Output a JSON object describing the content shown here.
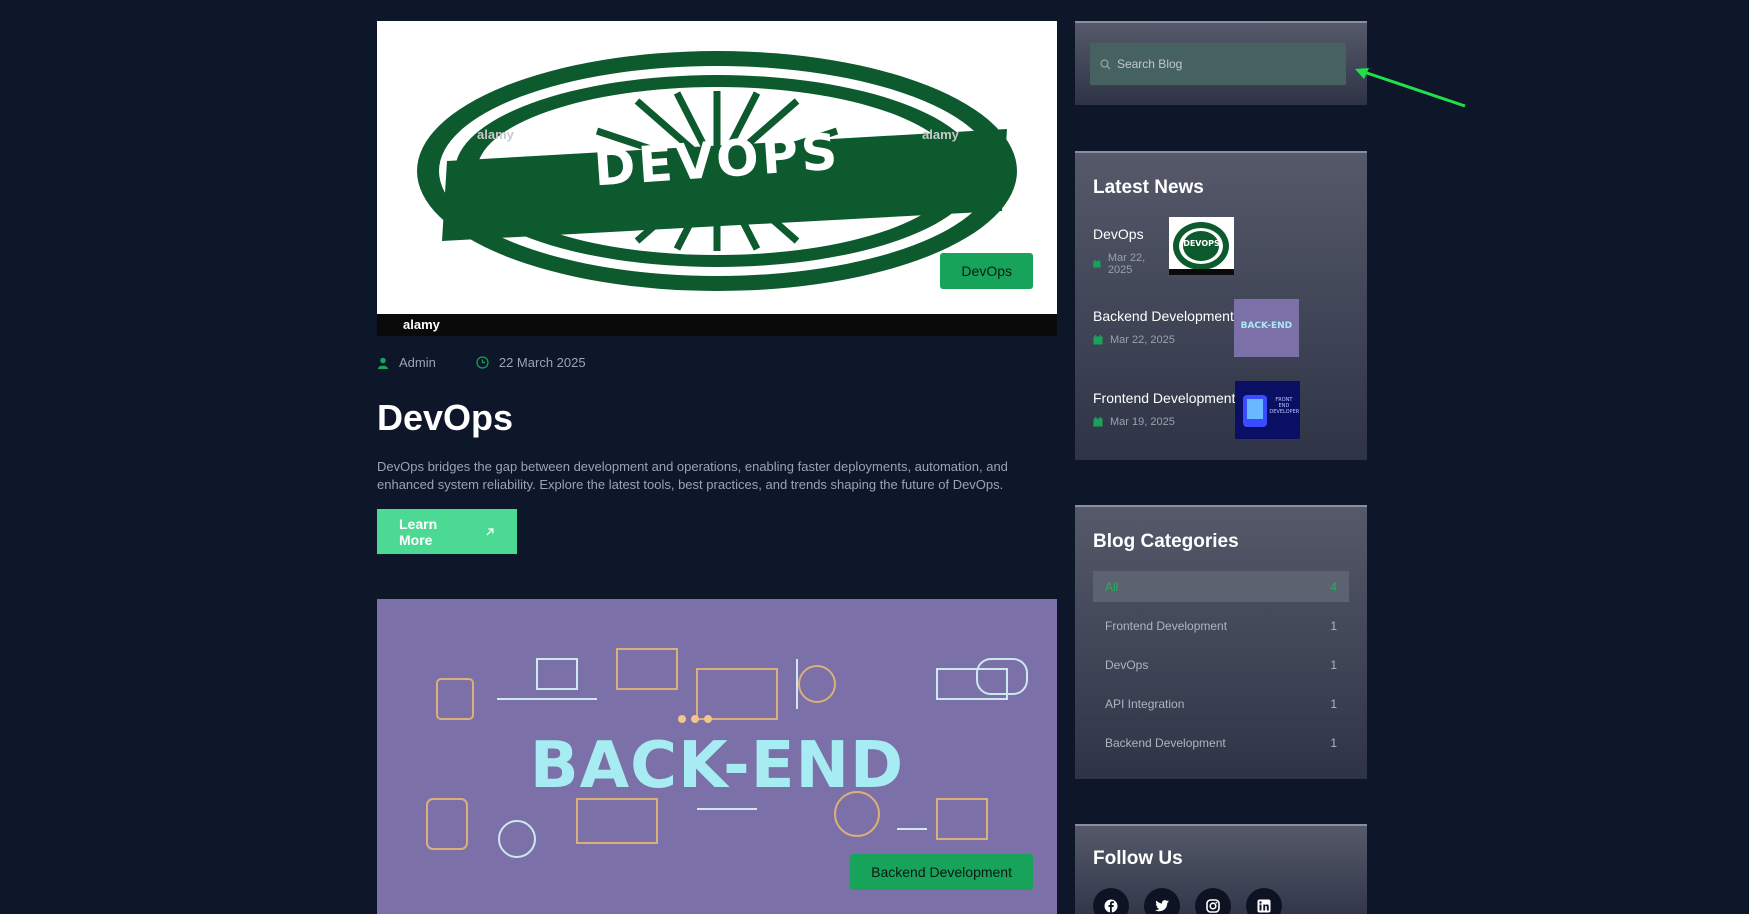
{
  "posts": [
    {
      "image_text": "DEVOPS",
      "image_watermark": "alamy",
      "category": "DevOps",
      "author": "Admin",
      "date": "22 March 2025",
      "title": "DevOps",
      "excerpt": "DevOps bridges the gap between development and operations, enabling faster deployments, automation, and enhanced system reliability. Explore the latest tools, best practices, and trends shaping the future of DevOps.",
      "cta": "Learn More"
    },
    {
      "image_text": "BACK-END",
      "category": "Backend Development"
    }
  ],
  "search": {
    "placeholder": "Search Blog"
  },
  "latest_news": {
    "title": "Latest News",
    "items": [
      {
        "title": "DevOps",
        "date": "Mar 22, 2025",
        "thumb_text": "DEVOPS"
      },
      {
        "title": "Backend Development",
        "date": "Mar 22, 2025",
        "thumb_text": "BACK-END"
      },
      {
        "title": "Frontend Development",
        "date": "Mar 19, 2025",
        "thumb_text": "FRONT END DEVELOPER"
      }
    ]
  },
  "categories": {
    "title": "Blog Categories",
    "items": [
      {
        "label": "All",
        "count": "4"
      },
      {
        "label": "Frontend Development",
        "count": "1"
      },
      {
        "label": "DevOps",
        "count": "1"
      },
      {
        "label": "API Integration",
        "count": "1"
      },
      {
        "label": "Backend Development",
        "count": "1"
      }
    ]
  },
  "follow": {
    "title": "Follow Us",
    "icons": [
      "facebook-icon",
      "twitter-icon",
      "instagram-icon",
      "linkedin-icon"
    ]
  },
  "colors": {
    "background": "#0e1629",
    "accent_green": "#17a35a",
    "button_green": "#4cd993",
    "annotation_arrow": "#22e04a"
  }
}
